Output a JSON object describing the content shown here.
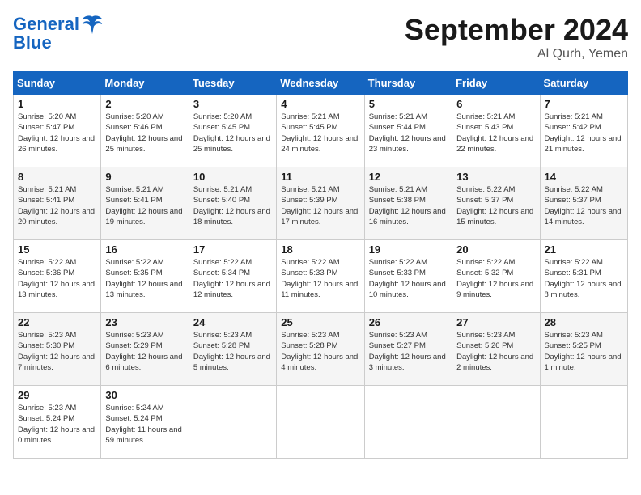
{
  "header": {
    "logo_line1": "General",
    "logo_line2": "Blue",
    "month": "September 2024",
    "location": "Al Qurh, Yemen"
  },
  "weekdays": [
    "Sunday",
    "Monday",
    "Tuesday",
    "Wednesday",
    "Thursday",
    "Friday",
    "Saturday"
  ],
  "weeks": [
    [
      {
        "day": "1",
        "sunrise": "5:20 AM",
        "sunset": "5:47 PM",
        "daylight": "12 hours and 26 minutes."
      },
      {
        "day": "2",
        "sunrise": "5:20 AM",
        "sunset": "5:46 PM",
        "daylight": "12 hours and 25 minutes."
      },
      {
        "day": "3",
        "sunrise": "5:20 AM",
        "sunset": "5:45 PM",
        "daylight": "12 hours and 25 minutes."
      },
      {
        "day": "4",
        "sunrise": "5:21 AM",
        "sunset": "5:45 PM",
        "daylight": "12 hours and 24 minutes."
      },
      {
        "day": "5",
        "sunrise": "5:21 AM",
        "sunset": "5:44 PM",
        "daylight": "12 hours and 23 minutes."
      },
      {
        "day": "6",
        "sunrise": "5:21 AM",
        "sunset": "5:43 PM",
        "daylight": "12 hours and 22 minutes."
      },
      {
        "day": "7",
        "sunrise": "5:21 AM",
        "sunset": "5:42 PM",
        "daylight": "12 hours and 21 minutes."
      }
    ],
    [
      {
        "day": "8",
        "sunrise": "5:21 AM",
        "sunset": "5:41 PM",
        "daylight": "12 hours and 20 minutes."
      },
      {
        "day": "9",
        "sunrise": "5:21 AM",
        "sunset": "5:41 PM",
        "daylight": "12 hours and 19 minutes."
      },
      {
        "day": "10",
        "sunrise": "5:21 AM",
        "sunset": "5:40 PM",
        "daylight": "12 hours and 18 minutes."
      },
      {
        "day": "11",
        "sunrise": "5:21 AM",
        "sunset": "5:39 PM",
        "daylight": "12 hours and 17 minutes."
      },
      {
        "day": "12",
        "sunrise": "5:21 AM",
        "sunset": "5:38 PM",
        "daylight": "12 hours and 16 minutes."
      },
      {
        "day": "13",
        "sunrise": "5:22 AM",
        "sunset": "5:37 PM",
        "daylight": "12 hours and 15 minutes."
      },
      {
        "day": "14",
        "sunrise": "5:22 AM",
        "sunset": "5:37 PM",
        "daylight": "12 hours and 14 minutes."
      }
    ],
    [
      {
        "day": "15",
        "sunrise": "5:22 AM",
        "sunset": "5:36 PM",
        "daylight": "12 hours and 13 minutes."
      },
      {
        "day": "16",
        "sunrise": "5:22 AM",
        "sunset": "5:35 PM",
        "daylight": "12 hours and 13 minutes."
      },
      {
        "day": "17",
        "sunrise": "5:22 AM",
        "sunset": "5:34 PM",
        "daylight": "12 hours and 12 minutes."
      },
      {
        "day": "18",
        "sunrise": "5:22 AM",
        "sunset": "5:33 PM",
        "daylight": "12 hours and 11 minutes."
      },
      {
        "day": "19",
        "sunrise": "5:22 AM",
        "sunset": "5:33 PM",
        "daylight": "12 hours and 10 minutes."
      },
      {
        "day": "20",
        "sunrise": "5:22 AM",
        "sunset": "5:32 PM",
        "daylight": "12 hours and 9 minutes."
      },
      {
        "day": "21",
        "sunrise": "5:22 AM",
        "sunset": "5:31 PM",
        "daylight": "12 hours and 8 minutes."
      }
    ],
    [
      {
        "day": "22",
        "sunrise": "5:23 AM",
        "sunset": "5:30 PM",
        "daylight": "12 hours and 7 minutes."
      },
      {
        "day": "23",
        "sunrise": "5:23 AM",
        "sunset": "5:29 PM",
        "daylight": "12 hours and 6 minutes."
      },
      {
        "day": "24",
        "sunrise": "5:23 AM",
        "sunset": "5:28 PM",
        "daylight": "12 hours and 5 minutes."
      },
      {
        "day": "25",
        "sunrise": "5:23 AM",
        "sunset": "5:28 PM",
        "daylight": "12 hours and 4 minutes."
      },
      {
        "day": "26",
        "sunrise": "5:23 AM",
        "sunset": "5:27 PM",
        "daylight": "12 hours and 3 minutes."
      },
      {
        "day": "27",
        "sunrise": "5:23 AM",
        "sunset": "5:26 PM",
        "daylight": "12 hours and 2 minutes."
      },
      {
        "day": "28",
        "sunrise": "5:23 AM",
        "sunset": "5:25 PM",
        "daylight": "12 hours and 1 minute."
      }
    ],
    [
      {
        "day": "29",
        "sunrise": "5:23 AM",
        "sunset": "5:24 PM",
        "daylight": "12 hours and 0 minutes."
      },
      {
        "day": "30",
        "sunrise": "5:24 AM",
        "sunset": "5:24 PM",
        "daylight": "11 hours and 59 minutes."
      },
      null,
      null,
      null,
      null,
      null
    ]
  ]
}
